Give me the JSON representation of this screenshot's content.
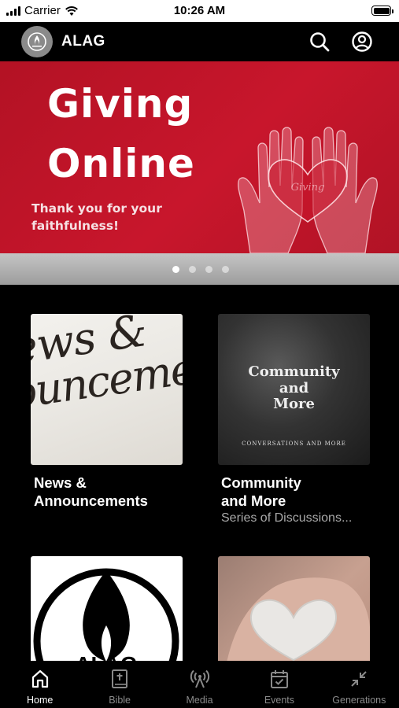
{
  "status_bar": {
    "carrier": "Carrier",
    "time": "10:26 AM"
  },
  "header": {
    "title": "ALAG",
    "logo_icon": "flame-logo-icon",
    "search_icon": "search-icon",
    "profile_icon": "user-circle-icon"
  },
  "banner": {
    "title_line1": "Giving",
    "title_line2": "Online",
    "subtitle_line1": "Thank you for your",
    "subtitle_line2": "faithfulness!",
    "heart_text": "Giving",
    "background_color": "#c8162c",
    "slide_count": 4,
    "active_slide": 1
  },
  "cards": [
    {
      "title_line1": "News &",
      "title_line2": "Announcements",
      "subtitle": "",
      "image_line1": "ews &",
      "image_line2": "ouncemen"
    },
    {
      "title_line1": "Community",
      "title_line2": "and More",
      "subtitle": "Series of Discussions...",
      "image_line1": "Community",
      "image_line2": "and",
      "image_line3": "More",
      "image_sub": "CONVERSATIONS AND MORE"
    },
    {
      "title_line1": "",
      "title_line2": "",
      "subtitle": "",
      "image_text": "ALAG"
    },
    {
      "title_line1": "",
      "title_line2": "",
      "subtitle": ""
    }
  ],
  "tabs": [
    {
      "label": "Home",
      "icon": "home-icon",
      "active": true
    },
    {
      "label": "Bible",
      "icon": "bible-icon",
      "active": false
    },
    {
      "label": "Media",
      "icon": "broadcast-icon",
      "active": false
    },
    {
      "label": "Events",
      "icon": "calendar-check-icon",
      "active": false
    },
    {
      "label": "Generations",
      "icon": "collapse-arrows-icon",
      "active": false
    }
  ]
}
